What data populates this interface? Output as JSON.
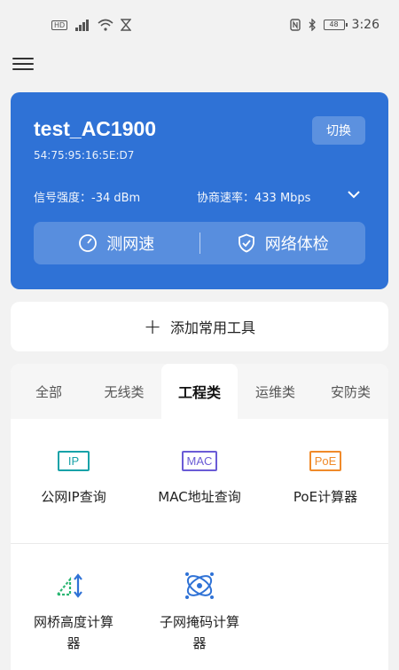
{
  "status_bar": {
    "left_icons": [
      "hd-icon",
      "signal-icon",
      "wifi-icon",
      "hourglass-icon"
    ],
    "hd_label": "HD",
    "battery": "48",
    "time": "3:26",
    "right_icons": [
      "nfc-icon",
      "bluetooth-icon",
      "battery-icon"
    ]
  },
  "router": {
    "name": "test_AC1900",
    "mac": "54:75:95:16:5E:D7",
    "switch_label": "切换",
    "signal": "信号强度：-34 dBm",
    "rate": "协商速率：433 Mbps",
    "speed_test": "测网速",
    "health_check": "网络体检",
    "card_color": "#2f72d6"
  },
  "add_tool": {
    "label": "添加常用工具"
  },
  "tabs": [
    {
      "label": "全部",
      "active": false
    },
    {
      "label": "无线类",
      "active": false
    },
    {
      "label": "工程类",
      "active": true
    },
    {
      "label": "运维类",
      "active": false
    },
    {
      "label": "安防类",
      "active": false
    }
  ],
  "tools": [
    {
      "label": "公网IP查询",
      "icon": "ip-icon",
      "icon_text": "IP",
      "color": "#17a2a8"
    },
    {
      "label": "MAC地址查询",
      "icon": "mac-icon",
      "icon_text": "MAC",
      "color": "#6a5bd6"
    },
    {
      "label": "PoE计算器",
      "icon": "poe-icon",
      "icon_text": "PoE",
      "color": "#f08a2a"
    },
    {
      "label": "网桥高度计算器",
      "icon": "bridge-height-icon",
      "color": "#2bb673"
    },
    {
      "label": "子网掩码计算器",
      "icon": "subnet-mask-icon",
      "color": "#2f72d6"
    }
  ]
}
